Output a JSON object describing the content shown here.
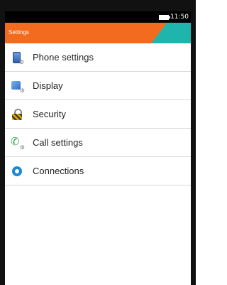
{
  "status_bar": {
    "time": "11:50"
  },
  "header": {
    "title": "Settings"
  },
  "menu": {
    "items": [
      {
        "label": "Phone settings",
        "icon": "phone-settings-icon"
      },
      {
        "label": "Display",
        "icon": "display-icon"
      },
      {
        "label": "Security",
        "icon": "lock-icon"
      },
      {
        "label": "Call settings",
        "icon": "call-settings-icon"
      },
      {
        "label": "Connections",
        "icon": "connections-icon"
      }
    ]
  },
  "colors": {
    "header": "#f26b1f",
    "accent": "#1fb5ad"
  }
}
